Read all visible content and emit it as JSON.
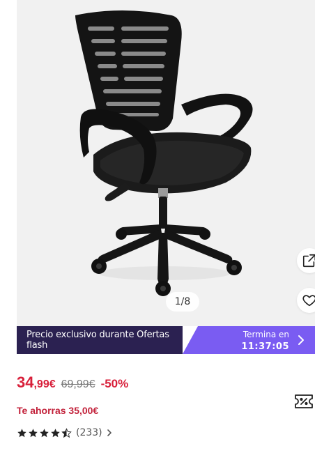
{
  "gallery": {
    "counter": "1/8",
    "share_icon": "share-external-icon",
    "favorite_icon": "heart-outline-icon"
  },
  "flash_banner": {
    "text": "Precio exclusivo durante Ofertas flash",
    "ends_label": "Termina en",
    "countdown": "11:37:05",
    "left_color": "#2b2151",
    "right_color": "#7a5cf2"
  },
  "price": {
    "current_integer": "34",
    "current_decimal": ",99€",
    "original": "69,99€",
    "discount": "-50%",
    "color": "#d81e39"
  },
  "savings": {
    "text": "Te ahorras 35,00€"
  },
  "coupon": {
    "icon": "coupon-ticket-icon"
  },
  "rating": {
    "stars": 4.5,
    "count": "(233)",
    "star_color": "#222222"
  }
}
